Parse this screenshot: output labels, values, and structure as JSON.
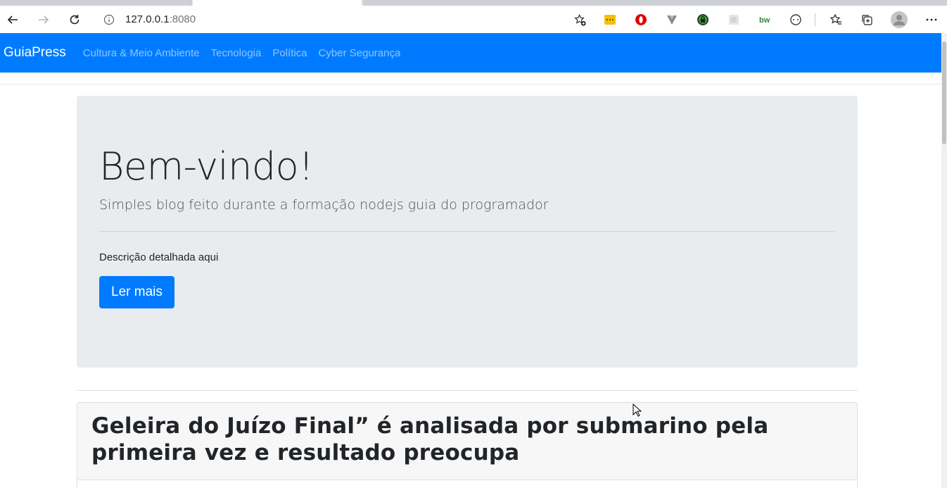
{
  "browser": {
    "url_host": "127.0.0.1",
    "url_port": ":8080",
    "icons": {
      "back": "arrow-left-icon",
      "forward": "arrow-right-icon",
      "reload": "reload-icon",
      "info": "info-icon",
      "add_favorite": "star-plus-icon",
      "favorites": "favorites-icon",
      "collections": "collections-icon",
      "profile": "profile-icon",
      "menu": "more-icon"
    },
    "extensions": [
      "yellow-note-extension-icon",
      "opera-red-extension-icon",
      "gray-v-extension-icon",
      "green-lock-extension-icon",
      "puzzle-extension-icon",
      "bw-extension-icon",
      "circle-dots-extension-icon"
    ]
  },
  "navbar": {
    "brand": "GuiaPress",
    "links": [
      "Cultura & Meio Ambiente",
      "Tecnologia",
      "Política",
      "Cyber Segurança"
    ],
    "bg_color": "#007bff"
  },
  "jumbotron": {
    "title": "Bem-vindo!",
    "lead": "Simples blog feito durante a formação nodejs guia do programador",
    "description": "Descrição detalhada aqui",
    "button_label": "Ler mais"
  },
  "articles": [
    {
      "title": "Geleira do Juízo Final” é analisada por submarino pela primeira vez e resultado preocupa"
    }
  ]
}
